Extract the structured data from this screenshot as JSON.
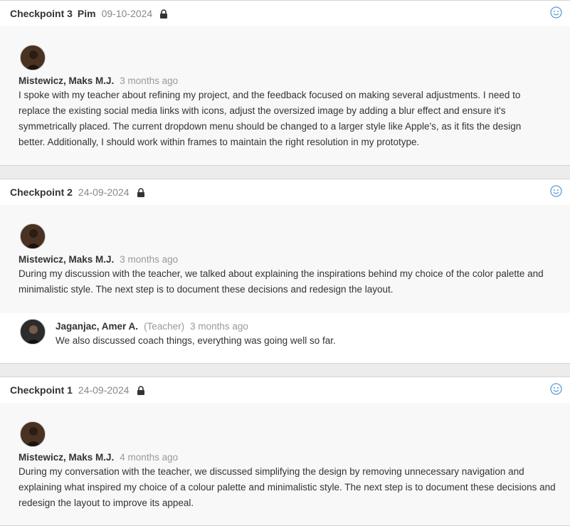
{
  "checkpoints": [
    {
      "title": "Checkpoint 3",
      "author_tag": "Pim",
      "date": "09-10-2024",
      "entries": [
        {
          "name": "Mistewicz, Maks M.J.",
          "time": "3 months ago",
          "text": "I spoke with my teacher about refining my project, and the feedback focused on making several adjustments. I need to replace the existing social media links with icons, adjust the oversized image by adding a blur effect and ensure it's symmetrically placed. The current dropdown menu should be changed to a larger style like Apple's, as it fits the design better. Additionally, I should work within frames to maintain the right resolution in my prototype."
        }
      ]
    },
    {
      "title": "Checkpoint 2",
      "date": "24-09-2024",
      "entries": [
        {
          "name": "Mistewicz, Maks M.J.",
          "time": "3 months ago",
          "text": "During my discussion with the teacher, we talked about explaining the inspirations behind my choice of the color palette and minimalistic style. The next step is to document these decisions and redesign the layout."
        }
      ],
      "reply": {
        "name": "Jaganjac, Amer A.",
        "role": "(Teacher)",
        "time": "3 months ago",
        "text": "We also discussed coach things, everything was going well so far."
      }
    },
    {
      "title": "Checkpoint 1",
      "date": "24-09-2024",
      "entries": [
        {
          "name": "Mistewicz, Maks M.J.",
          "time": "4 months ago",
          "text": "During my conversation with the teacher, we discussed simplifying the design by removing unnecessary navigation and explaining what inspired my choice of a colour palette and minimalistic style. The next step is to document these decisions and redesign the layout to improve its appeal."
        }
      ]
    }
  ],
  "icons": {
    "lock": "lock-icon",
    "reaction": "smiley-face-icon"
  },
  "colors": {
    "reaction_icon": "#5b9bd5",
    "muted_text": "#888888"
  }
}
